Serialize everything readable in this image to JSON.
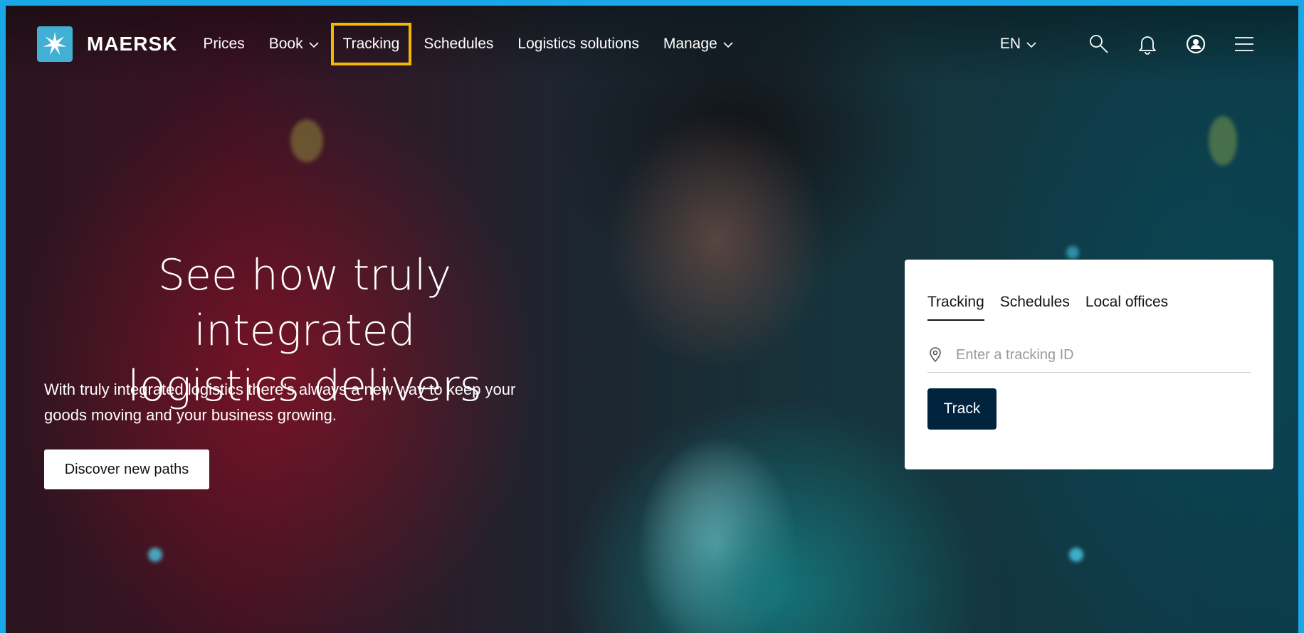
{
  "brand": {
    "name": "MAERSK",
    "logo_color": "#42b0d5"
  },
  "nav": {
    "items": [
      {
        "label": "Prices",
        "has_dropdown": false
      },
      {
        "label": "Book",
        "has_dropdown": true
      },
      {
        "label": "Tracking",
        "has_dropdown": false,
        "highlighted": true
      },
      {
        "label": "Schedules",
        "has_dropdown": false
      },
      {
        "label": "Logistics solutions",
        "has_dropdown": false
      },
      {
        "label": "Manage",
        "has_dropdown": true
      }
    ],
    "language": "EN",
    "icons": [
      "search-icon",
      "bell-icon",
      "user-icon",
      "menu-icon"
    ]
  },
  "hero": {
    "headline_line1": "See how truly integrated",
    "headline_line2": "logistics delivers",
    "subtext_line1": "With truly integrated logistics there’s always a new way to keep your",
    "subtext_line2": "goods moving and your business growing.",
    "cta_label": "Discover new paths"
  },
  "widget": {
    "tabs": [
      {
        "label": "Tracking",
        "active": true
      },
      {
        "label": "Schedules",
        "active": false
      },
      {
        "label": "Local offices",
        "active": false
      }
    ],
    "input_placeholder": "Enter a tracking ID",
    "input_value": "",
    "button_label": "Track",
    "button_color": "#00243d"
  },
  "colors": {
    "highlight": "#f5b800",
    "frame": "#1aa7e8"
  }
}
